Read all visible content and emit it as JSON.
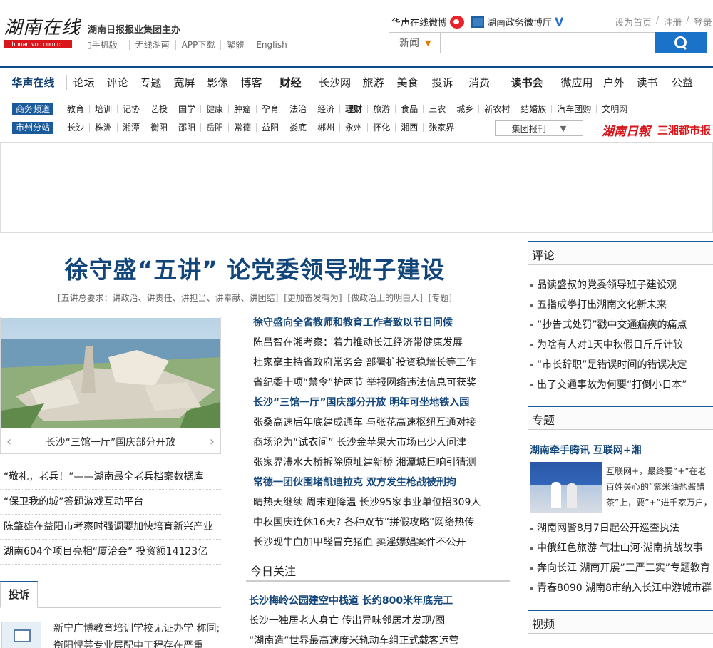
{
  "header": {
    "logo_text": "湖南在线",
    "logo_url_text": "hunan.voc.com.cn",
    "slogan": "湖南日报报业集团主办",
    "sublinks": [
      "手机版",
      "无线湖南",
      "APP下载",
      "繁體",
      "English"
    ],
    "weibo1": "华声在线微博",
    "weibo2": "湖南政务微博厅",
    "toplinks": [
      "设为首页",
      "注册",
      "登录"
    ],
    "search_category": "新闻",
    "search_placeholder": ""
  },
  "nav": {
    "items": [
      {
        "label": "华声在线",
        "bold": true
      },
      {
        "label": "论坛"
      },
      {
        "label": "评论"
      },
      {
        "label": "专题"
      },
      {
        "label": "宽屏"
      },
      {
        "label": "影像"
      },
      {
        "label": "博客"
      },
      {
        "label": "财经",
        "bold": true
      },
      {
        "label": "长沙网"
      },
      {
        "label": "旅游"
      },
      {
        "label": "美食"
      },
      {
        "label": "投诉"
      },
      {
        "label": "消费"
      },
      {
        "label": "读书会",
        "bold": true
      },
      {
        "label": "微应用"
      },
      {
        "label": "户外"
      },
      {
        "label": "读书"
      },
      {
        "label": "公益"
      }
    ]
  },
  "subnav1": {
    "tag": "商务频道",
    "items": [
      "教育",
      "培训",
      "记协",
      "艺投",
      "国学",
      "健康",
      "肿瘤",
      "孕育",
      "法治",
      "经济",
      "理财",
      "旅游",
      "食品",
      "三农",
      "城乡",
      "新农村",
      "结婚族",
      "汽车团购",
      "文明网"
    ]
  },
  "subnav2": {
    "tag": "市州分站",
    "items": [
      "长沙",
      "株洲",
      "湘潭",
      "衡阳",
      "邵阳",
      "岳阳",
      "常德",
      "益阳",
      "娄底",
      "郴州",
      "永州",
      "怀化",
      "湘西",
      "张家界"
    ],
    "group_select": "集团报刊",
    "paper1": "湖南日報",
    "paper2": "三湘都市报"
  },
  "headline": {
    "title": "徐守盛“五讲” 论党委领导班子建设",
    "sub": [
      "[五讲总要求：讲政治、讲责任、讲担当、讲奉献、讲团结]",
      "[更加奋发有为]",
      "[做政治上的明白人]",
      "[专题]"
    ]
  },
  "photo": {
    "caption": "长沙“三馆一厅”国庆部分开放",
    "prev": "‹",
    "next": "›"
  },
  "left_list": [
    "“敬礼，老兵！”——湖南最全老兵档案数据库",
    "“保卫我的城”答题游戏互动平台",
    "陈肇雄在益阳市考察时强调要加快培育新兴产业",
    "湖南604个项目亮相“厦洽会” 投资额14123亿"
  ],
  "tousu": {
    "title": "投诉",
    "text": "新宁广博教育培训学校无证办学 称同;衡阳悍芸专业层配中工程存在严重"
  },
  "center_list": [
    {
      "text": "徐守盛向全省教师和教育工作者致以节日问候",
      "hl": true
    },
    {
      "text": "陈昌智在湘考察：着力推动长江经济带健康发展"
    },
    {
      "text": "杜家毫主持省政府常务会 部署扩投资稳增长等工作"
    },
    {
      "text": "省纪委十项“禁令”护两节 举报网络违法信息可获奖"
    },
    {
      "text": "长沙“三馆一厅”国庆部分开放 明年可坐地铁入园",
      "hl": true
    },
    {
      "text": "张桑高速后年底建成通车 与张花高速枢纽互通对接"
    },
    {
      "text": "商场沦为“试衣间” 长沙金苹果大市场已少人问津"
    },
    {
      "text": "张家界澧水大桥拆除原址建新桥 湘潭城巨响引猜测"
    },
    {
      "text": "常德一团伙围堵凯迪拉克 双方发生枪战被刑拘",
      "hl": true
    },
    {
      "text": "晴热天继续 周末迎降温 长沙95家事业单位招309人"
    },
    {
      "text": "中秋国庆连休16天? 各种双节”拼假攻略”网络热传"
    },
    {
      "text": "长沙现牛血加甲醛冒充猪血 卖淫嫖娼案件不公开"
    }
  ],
  "today": {
    "title": "今日关注",
    "items": [
      {
        "text": "长沙梅岭公园建空中栈道 长约800米年底完工",
        "hl": true
      },
      {
        "text": "长沙一独居老人身亡 传出异味邻居才发现/图"
      },
      {
        "text": "“湖南造”世界最高速度米轨动车组正式载客运营"
      }
    ]
  },
  "right": {
    "pinglun_title": "评论",
    "pinglun": [
      "品读盛叔的党委领导班子建设观",
      "五指成拳打出湖南文化新未来",
      "“抄告式处罚”戳中交通痼疾的痛点",
      "为啥有人对1天中秋假日斤斤计较",
      "“市长辞职”是错误时间的错误决定",
      "出了交通事故为何要“打倒小日本”"
    ],
    "zhuanti_title": "专题",
    "zhuanti_feature": "湖南牵手腾讯 互联网+湘",
    "zhuanti_text": "互联网+，最终要”+”在老百姓关心的”紫米油盐酱醋茶”上，要”+”进千家万户，真正为广",
    "zhuanti_list": [
      "湖南网警8月7日起公开巡查执法",
      "中俄红色旅游 气壮山河·湖南抗战故事",
      "奔向长江 湖南开展”三严三实”专题教育",
      "青春8090 湖南8市纳入长江中游城市群"
    ],
    "video_title": "视频"
  }
}
